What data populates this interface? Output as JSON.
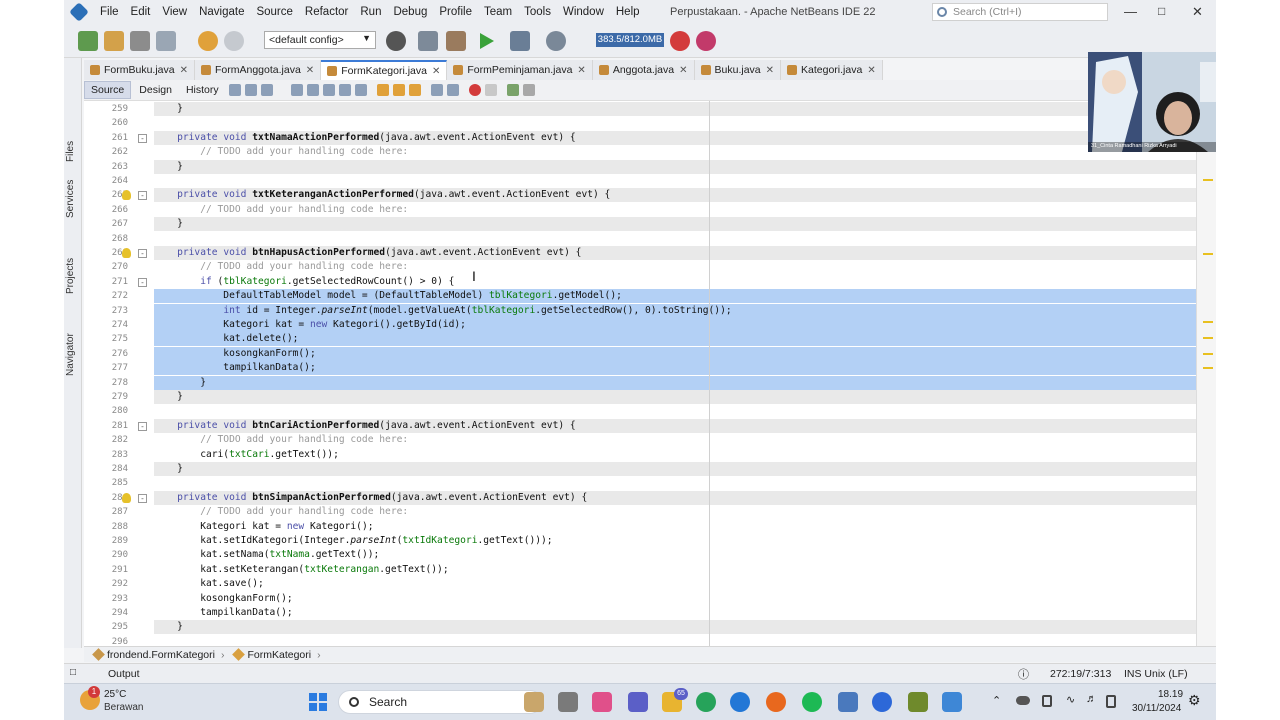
{
  "window": {
    "title": "Perpustakaan. - Apache NetBeans IDE 22",
    "search_placeholder": "Search (Ctrl+I)"
  },
  "menu": [
    "File",
    "Edit",
    "View",
    "Navigate",
    "Source",
    "Refactor",
    "Run",
    "Debug",
    "Profile",
    "Team",
    "Tools",
    "Window",
    "Help"
  ],
  "toolbar": {
    "config": "<default config>",
    "memory": "383.5/812.0MB"
  },
  "tabs": [
    {
      "label": "FormBuku.java",
      "active": false
    },
    {
      "label": "FormAnggota.java",
      "active": false
    },
    {
      "label": "FormKategori.java",
      "active": true
    },
    {
      "label": "FormPeminjaman.java",
      "active": false
    },
    {
      "label": "Anggota.java",
      "active": false
    },
    {
      "label": "Buku.java",
      "active": false
    },
    {
      "label": "Kategori.java",
      "active": false
    }
  ],
  "side_panels": [
    "Files",
    "Services",
    "Projects",
    "Navigator"
  ],
  "source_tabs": [
    "Source",
    "Design",
    "History"
  ],
  "code": [
    {
      "n": "259",
      "t": "    }"
    },
    {
      "n": "260",
      "t": ""
    },
    {
      "n": "261",
      "t": "    private void txtNamaActionPerformed(java.awt.event.ActionEvent evt) {"
    },
    {
      "n": "262",
      "t": "        // TODO add your handling code here:"
    },
    {
      "n": "263",
      "t": "    }"
    },
    {
      "n": "264",
      "t": ""
    },
    {
      "n": "265",
      "t": "    private void txtKeteranganActionPerformed(java.awt.event.ActionEvent evt) {"
    },
    {
      "n": "266",
      "t": "        // TODO add your handling code here:"
    },
    {
      "n": "267",
      "t": "    }"
    },
    {
      "n": "268",
      "t": ""
    },
    {
      "n": "269",
      "t": "    private void btnHapusActionPerformed(java.awt.event.ActionEvent evt) {"
    },
    {
      "n": "270",
      "t": "        // TODO add your handling code here:"
    },
    {
      "n": "271",
      "t": "        if (tblKategori.getSelectedRowCount() > 0) {"
    },
    {
      "n": "272",
      "t": "            DefaultTableModel model = (DefaultTableModel) tblKategori.getModel();"
    },
    {
      "n": "273",
      "t": "            int id = Integer.parseInt(model.getValueAt(tblKategori.getSelectedRow(), 0).toString());"
    },
    {
      "n": "274",
      "t": "            Kategori kat = new Kategori().getById(id);"
    },
    {
      "n": "275",
      "t": "            kat.delete();"
    },
    {
      "n": "276",
      "t": "            kosongkanForm();"
    },
    {
      "n": "277",
      "t": "            tampilkanData();"
    },
    {
      "n": "278",
      "t": "        }"
    },
    {
      "n": "279",
      "t": "    }"
    },
    {
      "n": "280",
      "t": ""
    },
    {
      "n": "281",
      "t": "    private void btnCariActionPerformed(java.awt.event.ActionEvent evt) {"
    },
    {
      "n": "282",
      "t": "        // TODO add your handling code here:"
    },
    {
      "n": "283",
      "t": "        cari(txtCari.getText());"
    },
    {
      "n": "284",
      "t": "    }"
    },
    {
      "n": "285",
      "t": ""
    },
    {
      "n": "286",
      "t": "    private void btnSimpanActionPerformed(java.awt.event.ActionEvent evt) {"
    },
    {
      "n": "287",
      "t": "        // TODO add your handling code here:"
    },
    {
      "n": "288",
      "t": "        Kategori kat = new Kategori();"
    },
    {
      "n": "289",
      "t": "        kat.setIdKategori(Integer.parseInt(txtIdKategori.getText()));"
    },
    {
      "n": "290",
      "t": "        kat.setNama(txtNama.getText());"
    },
    {
      "n": "291",
      "t": "        kat.setKeterangan(txtKeterangan.getText());"
    },
    {
      "n": "292",
      "t": "        kat.save();"
    },
    {
      "n": "293",
      "t": "        kosongkanForm();"
    },
    {
      "n": "294",
      "t": "        tampilkanData();"
    },
    {
      "n": "295",
      "t": "    }"
    },
    {
      "n": "296",
      "t": ""
    }
  ],
  "breadcrumb": {
    "package": "frondend.FormKategori",
    "class": "FormKategori"
  },
  "status": {
    "output": "Output",
    "position": "272:19/7:313",
    "mode": "INS Unix (LF)"
  },
  "webcam": {
    "name": "31_Cinta Ramadhani Rizka Arryadi"
  },
  "taskbar": {
    "weather_temp": "25°C",
    "weather_desc": "Berawan",
    "weather_badge": "1",
    "search": "Search",
    "whatsapp_badge": "65",
    "time": "18.19",
    "date": "30/11/2024"
  }
}
